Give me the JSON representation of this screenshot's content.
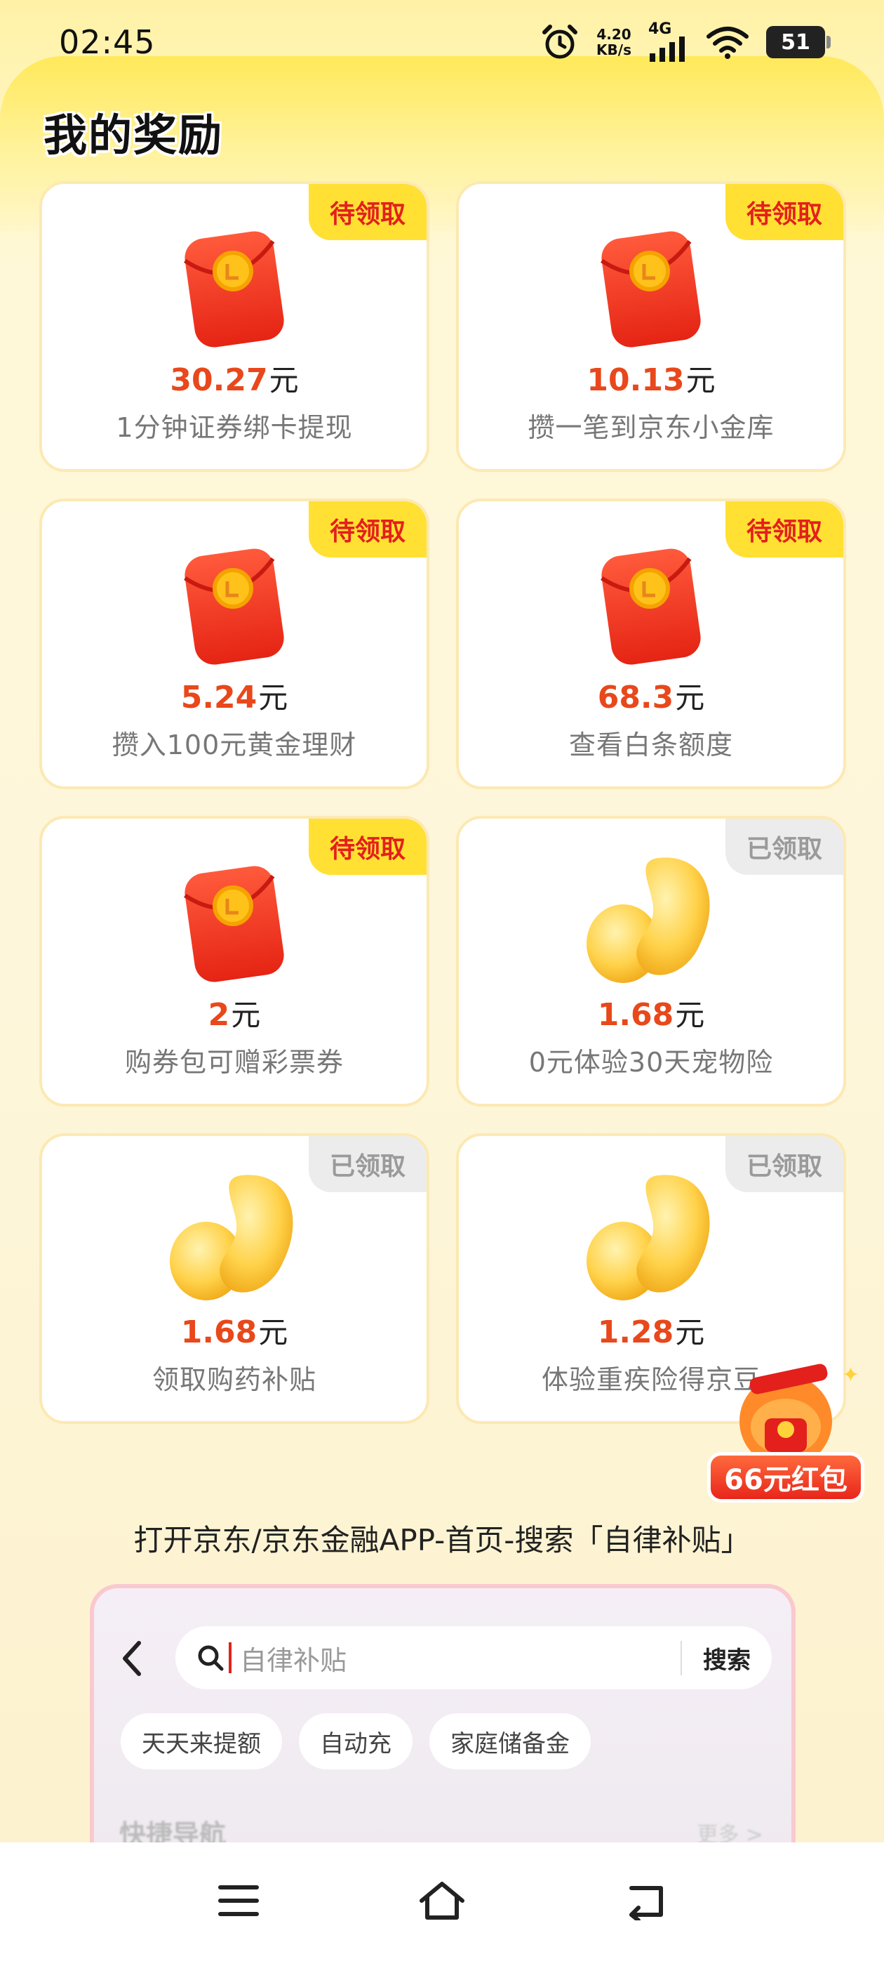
{
  "status_bar": {
    "time": "02:45",
    "net_speed_value": "4.20",
    "net_speed_unit": "KB/s",
    "network_type": "4G",
    "battery": "51",
    "icons": [
      "alarm-icon",
      "signal-icon",
      "wifi-icon",
      "battery-icon"
    ]
  },
  "header": {
    "title": "我的奖励",
    "more": "···"
  },
  "rewards": [
    {
      "amount": "30.27",
      "unit": "元",
      "desc": "1分钟证券绑卡提现",
      "badge": "待领取",
      "status": "pending",
      "icon": "red-envelope-icon"
    },
    {
      "amount": "10.13",
      "unit": "元",
      "desc": "攒一笔到京东小金库",
      "badge": "待领取",
      "status": "pending",
      "icon": "red-envelope-icon"
    },
    {
      "amount": "5.24",
      "unit": "元",
      "desc": "攒入100元黄金理财",
      "badge": "待领取",
      "status": "pending",
      "icon": "red-envelope-icon"
    },
    {
      "amount": "68.3",
      "unit": "元",
      "desc": "查看白条额度",
      "badge": "待领取",
      "status": "pending",
      "icon": "red-envelope-icon"
    },
    {
      "amount": "2",
      "unit": "元",
      "desc": "购券包可赠彩票券",
      "badge": "待领取",
      "status": "pending",
      "icon": "red-envelope-icon"
    },
    {
      "amount": "1.68",
      "unit": "元",
      "desc": "0元体验30天宠物险",
      "badge": "已领取",
      "status": "claimed",
      "icon": "gold-bean-icon"
    },
    {
      "amount": "1.68",
      "unit": "元",
      "desc": "领取购药补贴",
      "badge": "已领取",
      "status": "claimed",
      "icon": "gold-bean-icon"
    },
    {
      "amount": "1.28",
      "unit": "元",
      "desc": "体验重疾险得京豆",
      "badge": "已领取",
      "status": "claimed",
      "icon": "gold-bean-icon"
    }
  ],
  "floating_promo": {
    "label": "66元红包"
  },
  "instruction": "打开京东/京东金融APP-首页-搜索「自律补贴」",
  "preview": {
    "search_placeholder": "自律补贴",
    "search_button": "搜索",
    "chips": [
      "天天来提额",
      "自动充",
      "家庭储备金"
    ],
    "quick_nav_title": "快捷导航",
    "quick_nav_more": "更多 >"
  },
  "colors": {
    "accent_red": "#e8481b",
    "badge_yellow": "#ffe033",
    "badge_text_red": "#e3201c",
    "claimed_gray": "#ececec"
  }
}
